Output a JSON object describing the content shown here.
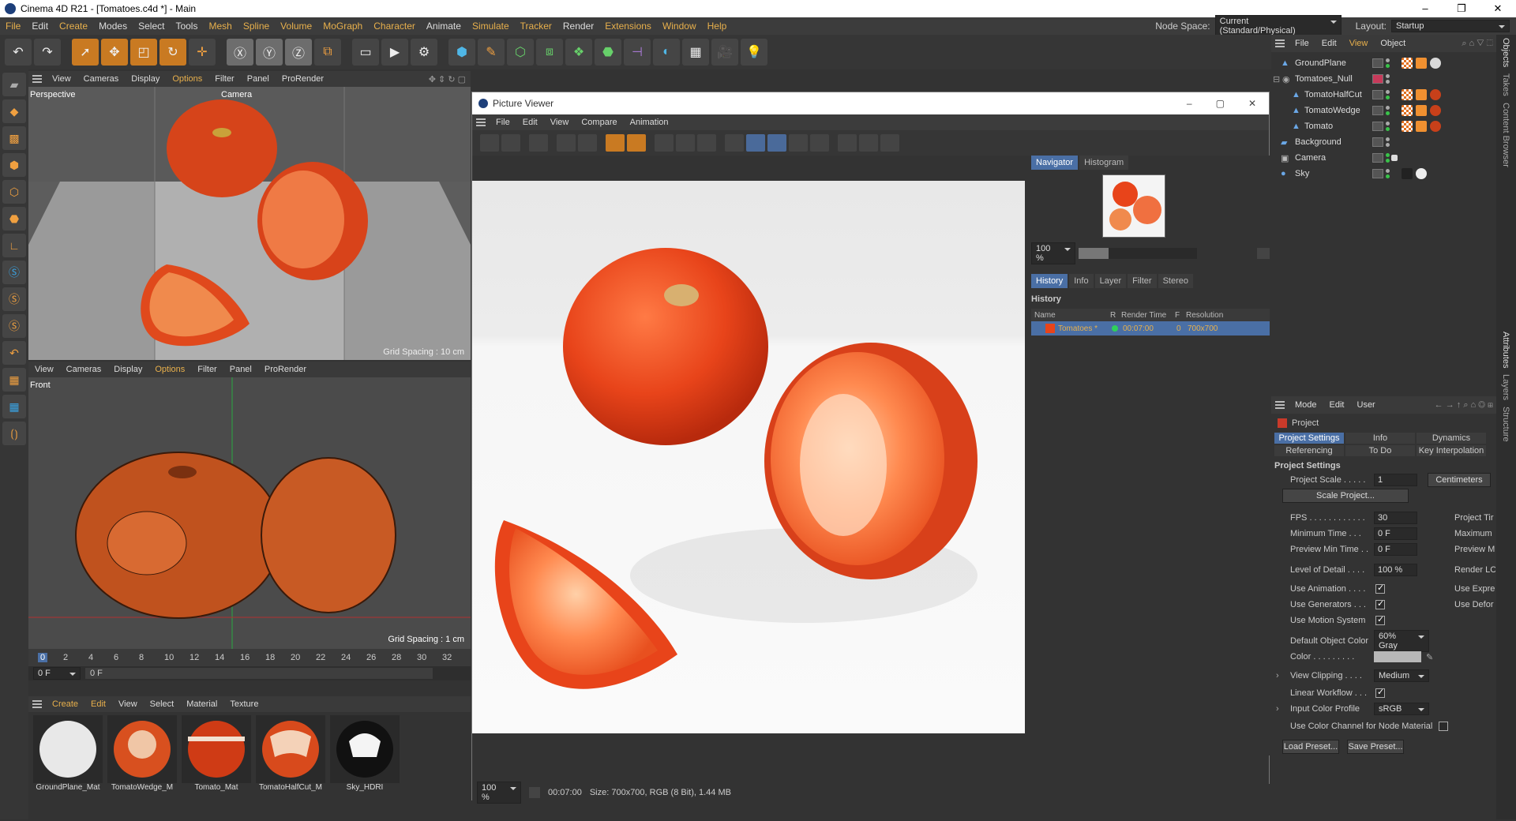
{
  "window": {
    "title": "Cinema 4D R21 - [Tomatoes.c4d *] - Main",
    "minimize": "–",
    "maximize": "❐",
    "close": "✕"
  },
  "menubar": {
    "items": [
      "File",
      "Edit",
      "Create",
      "Modes",
      "Select",
      "Tools",
      "Mesh",
      "Spline",
      "Volume",
      "MoGraph",
      "Character",
      "Animate",
      "Simulate",
      "Tracker",
      "Render",
      "Extensions",
      "Window",
      "Help"
    ],
    "node_space_label": "Node Space:",
    "node_space_value": "Current (Standard/Physical)",
    "layout_label": "Layout:",
    "layout_value": "Startup"
  },
  "viewport_menu": [
    "View",
    "Cameras",
    "Display",
    "Options",
    "Filter",
    "Panel",
    "ProRender"
  ],
  "viewport_top": {
    "name": "Perspective",
    "camera": "Camera",
    "grid": "Grid Spacing : 10 cm"
  },
  "viewport_bottom": {
    "name": "Front",
    "grid": "Grid Spacing : 1 cm"
  },
  "timeline": {
    "ticks": [
      "0",
      "2",
      "4",
      "6",
      "8",
      "10",
      "12",
      "14",
      "16",
      "18",
      "20",
      "22",
      "24",
      "26",
      "28",
      "30",
      "32"
    ],
    "current": "0 F",
    "field": "0 F"
  },
  "material_manager": {
    "menu": [
      "Create",
      "Edit",
      "View",
      "Select",
      "Material",
      "Texture"
    ],
    "materials": [
      "GroundPlane_Mat",
      "TomatoWedge_M",
      "Tomato_Mat",
      "TomatoHalfCut_M",
      "Sky_HDRI"
    ]
  },
  "picture_viewer": {
    "title": "Picture Viewer",
    "menu": [
      "File",
      "Edit",
      "View",
      "Compare",
      "Animation"
    ],
    "nav_tabs": [
      "Navigator",
      "Histogram"
    ],
    "zoom": "100 %",
    "hist_tabs": [
      "History",
      "Info",
      "Layer",
      "Filter",
      "Stereo"
    ],
    "history_title": "History",
    "history_cols": [
      "Name",
      "R",
      "Render Time",
      "F",
      "Resolution"
    ],
    "history_row": {
      "name": "Tomatoes *",
      "time": "00:07:00",
      "frame": "0",
      "res": "700x700"
    },
    "status_zoom": "100 %",
    "status_time": "00:07:00",
    "status_size": "Size: 700x700, RGB (8 Bit), 1.44 MB"
  },
  "objects": {
    "menu": [
      "File",
      "Edit",
      "View",
      "Object"
    ],
    "items": [
      {
        "name": "GroundPlane",
        "level": 0
      },
      {
        "name": "Tomatoes_Null",
        "level": 0
      },
      {
        "name": "TomatoHalfCut",
        "level": 1
      },
      {
        "name": "TomatoWedge",
        "level": 1
      },
      {
        "name": "Tomato",
        "level": 1
      },
      {
        "name": "Background",
        "level": 0
      },
      {
        "name": "Camera",
        "level": 0
      },
      {
        "name": "Sky",
        "level": 0
      }
    ]
  },
  "attributes": {
    "menu": [
      "Mode",
      "Edit",
      "User"
    ],
    "object": "Project",
    "tabs_row1": [
      "Project Settings",
      "Info",
      "Dynamics"
    ],
    "tabs_row2": [
      "Referencing",
      "To Do",
      "Key Interpolation"
    ],
    "section": "Project Settings",
    "project_scale_label": "Project Scale . . . . .",
    "project_scale_value": "1",
    "project_scale_unit": "Centimeters",
    "scale_project_btn": "Scale Project...",
    "fps_label": "FPS . . . . . . . . . . . .",
    "fps_value": "30",
    "fps_right": "Project Tir",
    "min_time_label": "Minimum Time . . .",
    "min_time_value": "0 F",
    "min_time_right": "Maximum",
    "preview_min_label": "Preview Min Time . .",
    "preview_min_value": "0 F",
    "preview_min_right": "Preview M",
    "lod_label": "Level of Detail . . . .",
    "lod_value": "100 %",
    "lod_right": "Render LC",
    "use_animation": "Use Animation . . . .",
    "use_animation_right": "Use Expre",
    "use_generators": "Use Generators . . .",
    "use_generators_right": "Use Defor",
    "use_motion": "Use Motion System",
    "default_color_label": "Default Object Color",
    "default_color_value": "60% Gray",
    "color_label": "Color . . . . . . . . .",
    "view_clipping_label": "View Clipping . . . .",
    "view_clipping_value": "Medium",
    "linear_workflow": "Linear Workflow . . .",
    "input_profile_label": "Input Color Profile",
    "input_profile_value": "sRGB",
    "use_color_channel": "Use Color Channel for Node Material",
    "load_preset": "Load Preset...",
    "save_preset": "Save Preset..."
  },
  "right_tabs": [
    "Objects",
    "Takes",
    "Content Browser",
    "Attributes",
    "Layers",
    "Structure"
  ]
}
